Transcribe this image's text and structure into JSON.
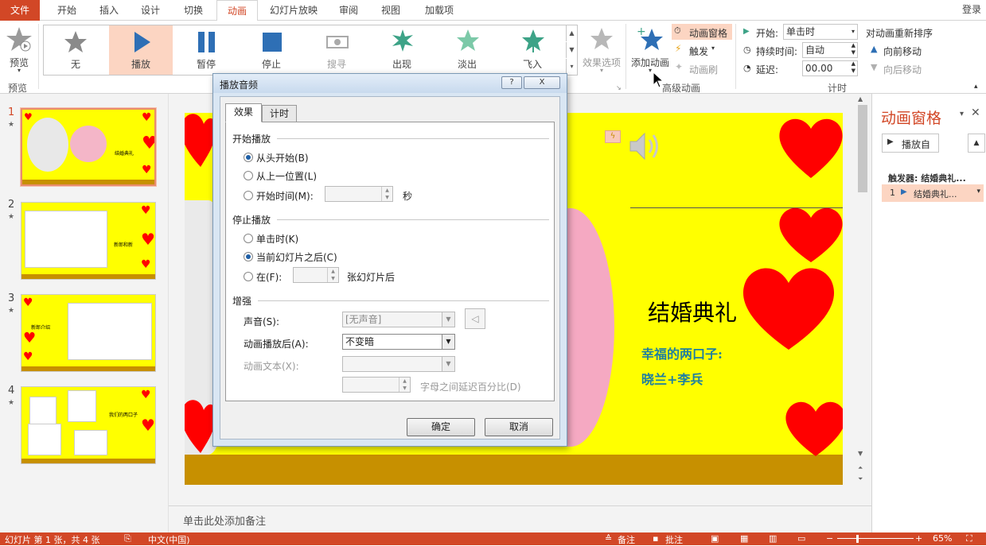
{
  "ribbon_tabs": {
    "file": "文件",
    "items": [
      "开始",
      "插入",
      "设计",
      "切换",
      "动画",
      "幻灯片放映",
      "审阅",
      "视图",
      "加载项"
    ],
    "login": "登录"
  },
  "ribbon": {
    "preview": {
      "label": "预览",
      "group": "预览"
    },
    "gallery": [
      "无",
      "播放",
      "暂停",
      "停止",
      "搜寻",
      "出现",
      "淡出",
      "飞入"
    ],
    "effect_options": "效果选项",
    "add_animation": "添加动画",
    "anim_pane_btn": "动画窗格",
    "trigger": "触发",
    "anim_painter": "动画刷",
    "advanced_group": "高级动画",
    "start_label": "开始:",
    "start_value": "单击时",
    "duration_label": "持续时间:",
    "duration_value": "自动",
    "delay_label": "延迟:",
    "delay_value": "00.00",
    "timing_group": "计时",
    "reorder": "对动画重新排序",
    "move_earlier": "向前移动",
    "move_later": "向后移动"
  },
  "thumbnails": [
    {
      "num": "1",
      "text": "结婚典礼"
    },
    {
      "num": "2",
      "text": "新郎和新"
    },
    {
      "num": "3",
      "text": "新郎介绍"
    },
    {
      "num": "4",
      "text": "我们的两口子"
    }
  ],
  "slide": {
    "title": "结婚典礼",
    "subtitle": "幸福的两口子:",
    "names": "晓兰+李兵"
  },
  "notes": "单击此处添加备注",
  "anim_pane": {
    "title": "动画窗格",
    "play": "播放自",
    "trigger": "触发器: 结婚典礼...",
    "item_num": "1",
    "item": "结婚典礼..."
  },
  "status": {
    "slide": "幻灯片 第 1 张，共 4 张",
    "lang": "中文(中国)",
    "notes": "备注",
    "comments": "批注",
    "zoom": "65%"
  },
  "dialog": {
    "title": "播放音频",
    "help": "?",
    "close": "X",
    "tabs": [
      "效果",
      "计时"
    ],
    "start_section": "开始播放",
    "start_options": [
      "从头开始(B)",
      "从上一位置(L)",
      "开始时间(M):"
    ],
    "seconds": "秒",
    "stop_section": "停止播放",
    "stop_options": [
      "单击时(K)",
      "当前幻灯片之后(C)",
      "在(F):"
    ],
    "slides_after": "张幻灯片后",
    "enhance_section": "增强",
    "sound_label": "声音(S):",
    "sound_value": "[无声音]",
    "after_anim_label": "动画播放后(A):",
    "after_anim_value": "不变暗",
    "anim_text_label": "动画文本(X):",
    "letter_delay": "字母之间延迟百分比(D)",
    "ok": "确定",
    "cancel": "取消"
  },
  "colors": {
    "accent": "#d24726",
    "slide_bg": "#ffff00",
    "heart": "#ff0000",
    "gold_bar": "#c79000",
    "text_teal": "#1e7fa0"
  }
}
